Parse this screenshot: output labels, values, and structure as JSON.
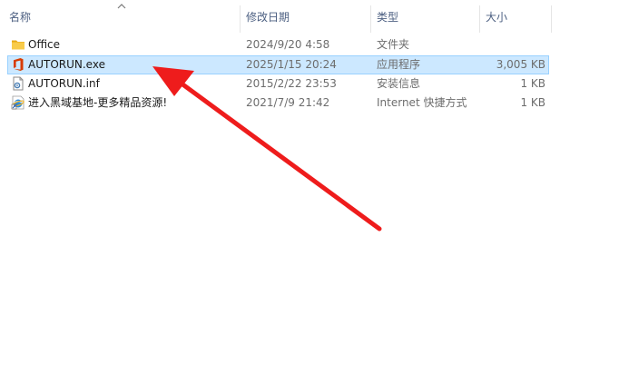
{
  "columns": {
    "name": "名称",
    "date": "修改日期",
    "type": "类型",
    "size": "大小"
  },
  "files": [
    {
      "name": "Office",
      "date": "2024/9/20 4:58",
      "type": "文件夹",
      "size": "",
      "icon": "folder-icon",
      "selected": false
    },
    {
      "name": "AUTORUN.exe",
      "date": "2025/1/15 20:24",
      "type": "应用程序",
      "size": "3,005 KB",
      "icon": "office-app-icon",
      "selected": true
    },
    {
      "name": "AUTORUN.inf",
      "date": "2015/2/22 23:53",
      "type": "安装信息",
      "size": "1 KB",
      "icon": "settings-file-icon",
      "selected": false
    },
    {
      "name": "进入黑域基地-更多精品资源!",
      "date": "2021/7/9 21:42",
      "type": "Internet 快捷方式",
      "size": "1 KB",
      "icon": "internet-shortcut-icon",
      "selected": false
    }
  ],
  "colors": {
    "selection_bg": "#cce8ff",
    "selection_border": "#99d1ff",
    "annotation_arrow": "#ee1c1c",
    "folder": "#f5c242",
    "office": "#d83b01"
  }
}
